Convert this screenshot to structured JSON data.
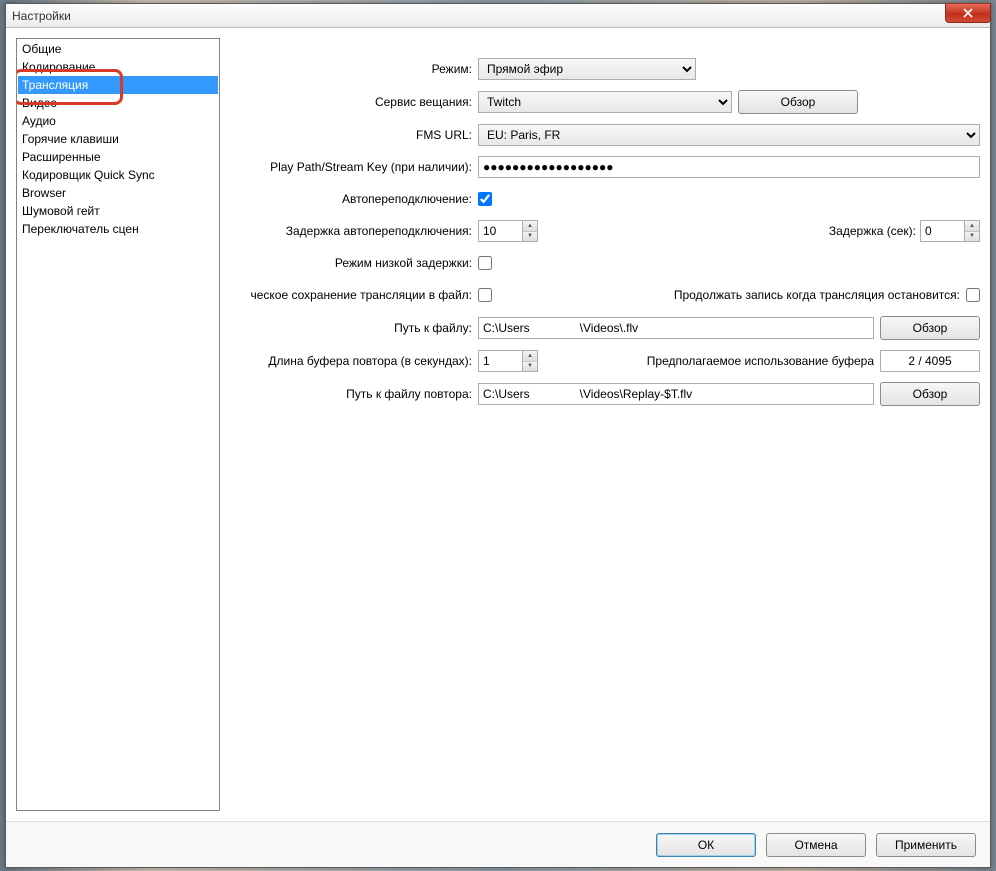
{
  "window": {
    "title": "Настройки"
  },
  "sidebar": {
    "items": [
      "Общие",
      "Кодирование",
      "Трансляция",
      "Видео",
      "Аудио",
      "Горячие клавиши",
      "Расширенные",
      "Кодировщик Quick Sync",
      "Browser",
      "Шумовой гейт",
      "Переключатель сцен"
    ],
    "selected_index": 2,
    "highlight_index": 2
  },
  "form": {
    "mode": {
      "label": "Режим:",
      "value": "Прямой эфир"
    },
    "service": {
      "label": "Сервис вещания:",
      "value": "Twitch",
      "browse": "Обзор"
    },
    "fms": {
      "label": "FMS URL:",
      "value": "EU: Paris, FR"
    },
    "streamkey": {
      "label": "Play Path/Stream Key (при наличии):",
      "value": "●●●●●●●●●●●●●●●●●●"
    },
    "autoreconnect": {
      "label": "Автопереподключение:",
      "checked": true
    },
    "reconnect_delay": {
      "label": "Задержка автопереподключения:",
      "value": "10"
    },
    "delay_sec": {
      "label": "Задержка (сек):",
      "value": "0"
    },
    "low_latency": {
      "label": "Режим низкой задержки:"
    },
    "save_to_file": {
      "label": "ческое сохранение трансляции в файл:"
    },
    "continue_record": {
      "label": "Продолжать запись когда трансляция остановится:"
    },
    "file_path": {
      "label": "Путь к файлу:",
      "value": "C:\\Users               \\Videos\\.flv",
      "browse": "Обзор"
    },
    "buffer_len": {
      "label": "Длина буфера повтора (в секундах):",
      "value": "1"
    },
    "buffer_est": {
      "label": "Предполагаемое использование буфера",
      "value": "2 / 4095"
    },
    "replay_path": {
      "label": "Путь к файлу повтора:",
      "value": "C:\\Users               \\Videos\\Replay-$T.flv",
      "browse": "Обзор"
    }
  },
  "footer": {
    "ok": "ОК",
    "cancel": "Отмена",
    "apply": "Применить"
  }
}
